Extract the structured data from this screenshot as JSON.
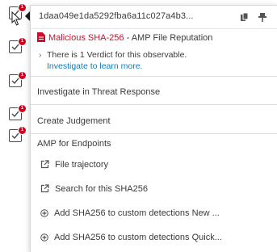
{
  "observable": {
    "hash": "1daa049e1da5292fba6a11c027a4b3..."
  },
  "verdict": {
    "label": "Malicious SHA-256",
    "separator": " - ",
    "source": "AMP File Reputation",
    "detail_line": "There is 1 Verdict for this observable.",
    "link_text": "Investigate to learn more."
  },
  "actions": {
    "investigate": "Investigate in Threat Response",
    "create_judgement": "Create Judgement"
  },
  "amp_section": {
    "title": "AMP for Endpoints",
    "items": [
      {
        "label": "File trajectory",
        "icon": "external-link-icon"
      },
      {
        "label": "Search for this SHA256",
        "icon": "external-link-icon"
      },
      {
        "label": "Add SHA256 to custom detections New ...",
        "icon": "plus-circle-icon"
      },
      {
        "label": "Add SHA256 to custom detections Quick...",
        "icon": "plus-circle-icon"
      }
    ]
  },
  "icons": {
    "header_left": "copy-icon",
    "header_right": "pin-icon",
    "verdict": "file-icon",
    "strip": "checkbox-icon"
  },
  "colors": {
    "malicious": "#c8102e",
    "link": "#0a7fbf",
    "badge": "#d0021b",
    "text": "#3a3a3a"
  },
  "badges": [
    "1",
    "1",
    "1",
    "1",
    "1"
  ]
}
